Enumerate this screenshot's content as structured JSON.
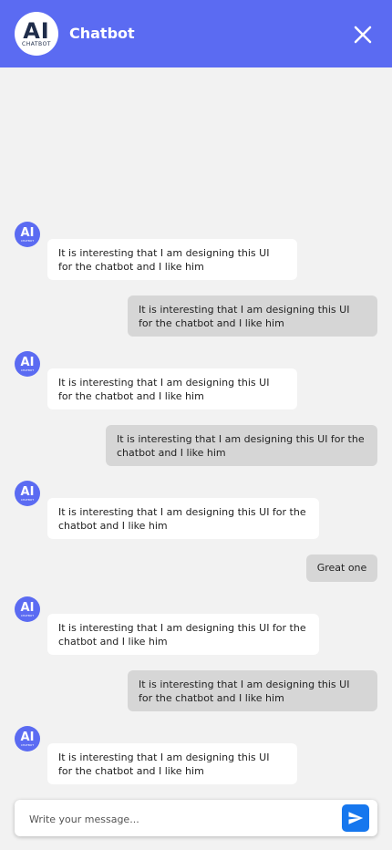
{
  "header": {
    "logo_text": "AI",
    "logo_subtext": "CHATBOT",
    "title": "Chatbot",
    "close_icon": "close-icon"
  },
  "messages": [
    {
      "sender": "bot",
      "text": "It is interesting that I am designing this UI for the chatbot and I like him"
    },
    {
      "sender": "user",
      "text": "It is interesting that I am designing this UI for the chatbot and I like him"
    },
    {
      "sender": "bot",
      "text": "It is interesting that I am designing this UI for the chatbot and I like him"
    },
    {
      "sender": "user",
      "text": "It is interesting that I am designing this UI for the chatbot and I like him"
    },
    {
      "sender": "bot",
      "text": "It is interesting that I am designing this UI for the chatbot and I like him"
    },
    {
      "sender": "user",
      "text": "Great one"
    },
    {
      "sender": "bot",
      "text": "It is interesting that I am designing this UI for the chatbot and I like him"
    },
    {
      "sender": "user",
      "text": "It is interesting that I am designing this UI for the chatbot and I like him"
    },
    {
      "sender": "bot",
      "text": "It is interesting that I am designing this UI for the chatbot and I like him"
    }
  ],
  "bot_avatar": {
    "text": "AI",
    "subtext": "CHATBOT"
  },
  "composer": {
    "placeholder": "Write your message...",
    "send_icon": "send-icon"
  },
  "colors": {
    "header": "#5b6bf2",
    "background": "#f2f2f2",
    "bot_bubble": "#ffffff",
    "user_bubble": "#d6d6d6",
    "send_button": "#1677ee"
  }
}
